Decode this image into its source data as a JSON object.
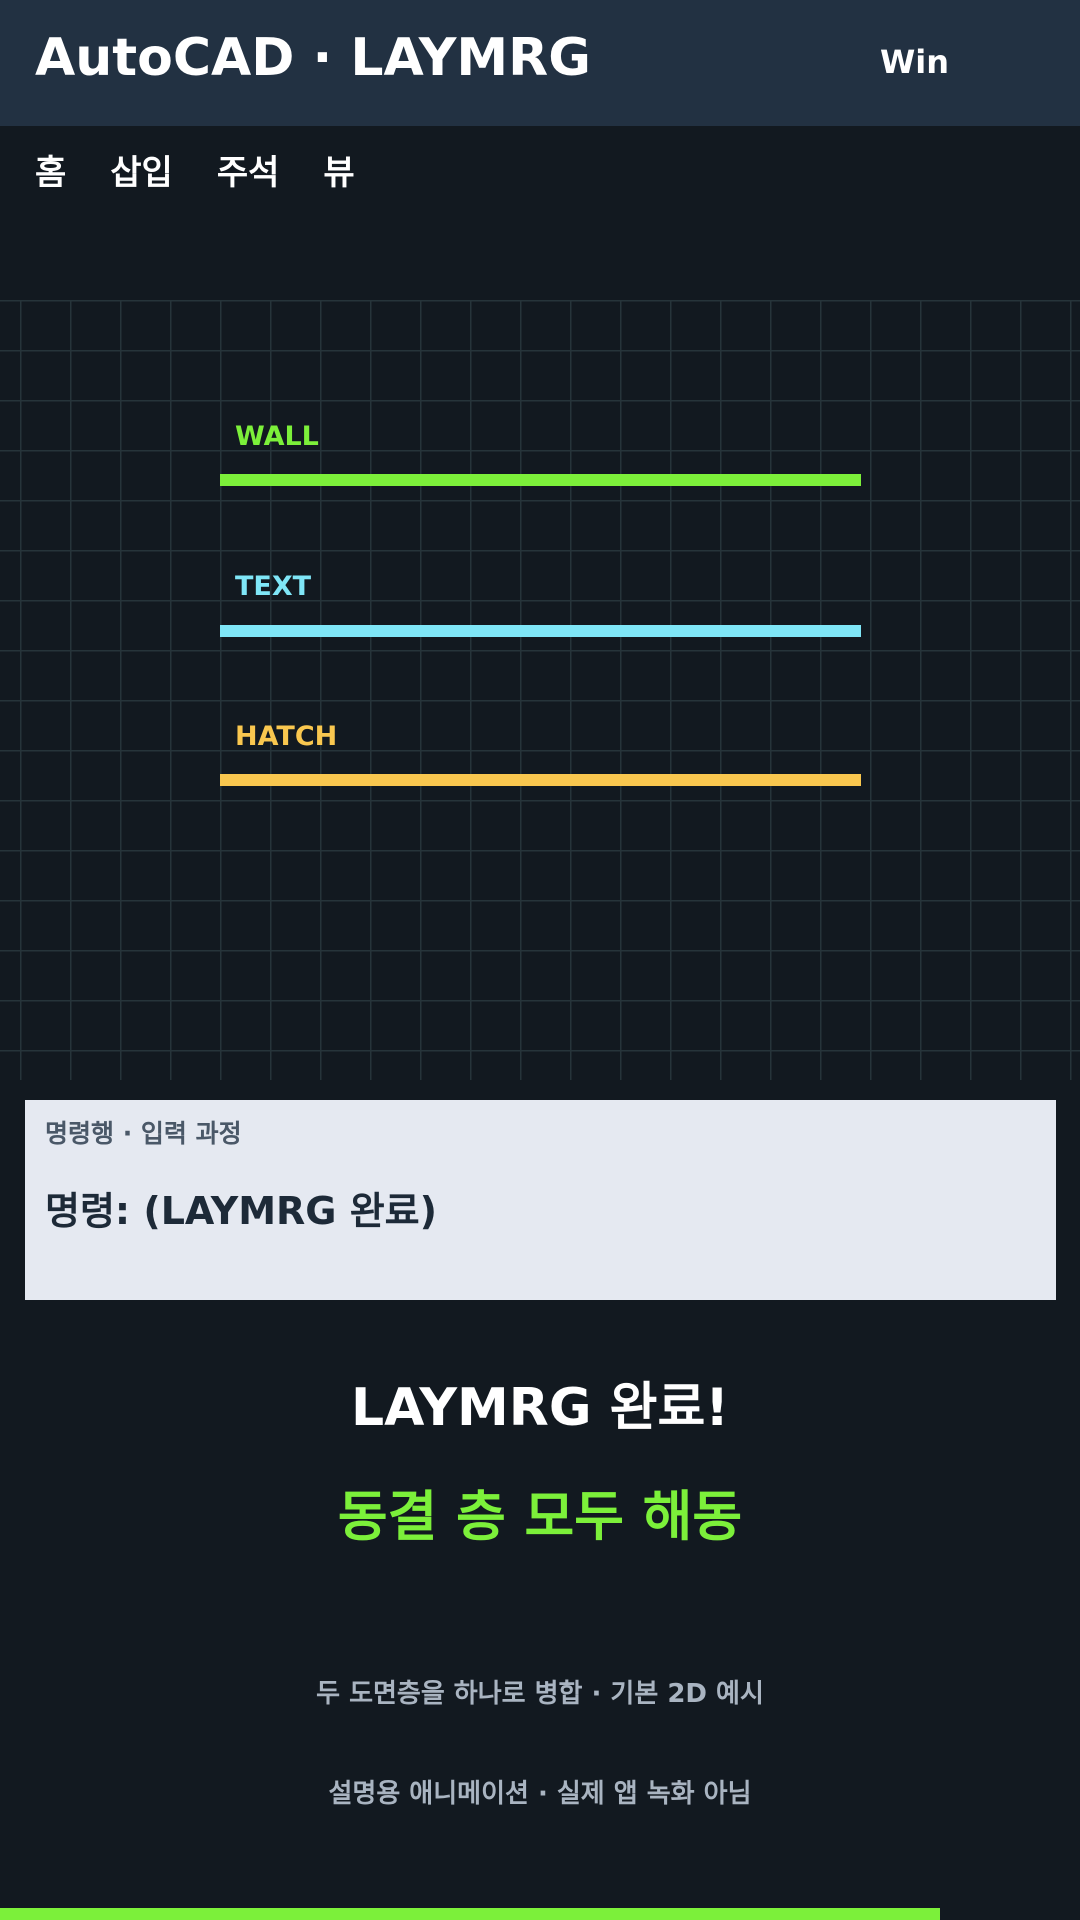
{
  "header": {
    "app_title": "AutoCAD · LAYMRG",
    "os_label": "Win"
  },
  "ribbon": {
    "tabs": [
      {
        "label": "홈"
      },
      {
        "label": "삽입"
      },
      {
        "label": "주석"
      },
      {
        "label": "뷰"
      }
    ]
  },
  "drawing": {
    "layers": [
      {
        "name": "WALL",
        "color": "#7cf03a"
      },
      {
        "name": "TEXT",
        "color": "#7fe6f7"
      },
      {
        "name": "HATCH",
        "color": "#f9c74f"
      }
    ]
  },
  "command_line": {
    "caption": "명령행 · 입력 과정",
    "text": "명령: (LAYMRG 완료)"
  },
  "result": {
    "title": "LAYMRG 완료!",
    "subtitle": "동결 층 모두 해동",
    "subtitle_color": "#7cf03a"
  },
  "notes": [
    "두 도면층을 하나로 병합 · 기본 2D 예시",
    "설명용 애니메이션 · 실제 앱 녹화 아님"
  ],
  "progress": {
    "fraction": 0.87,
    "color": "#7cf03a"
  }
}
